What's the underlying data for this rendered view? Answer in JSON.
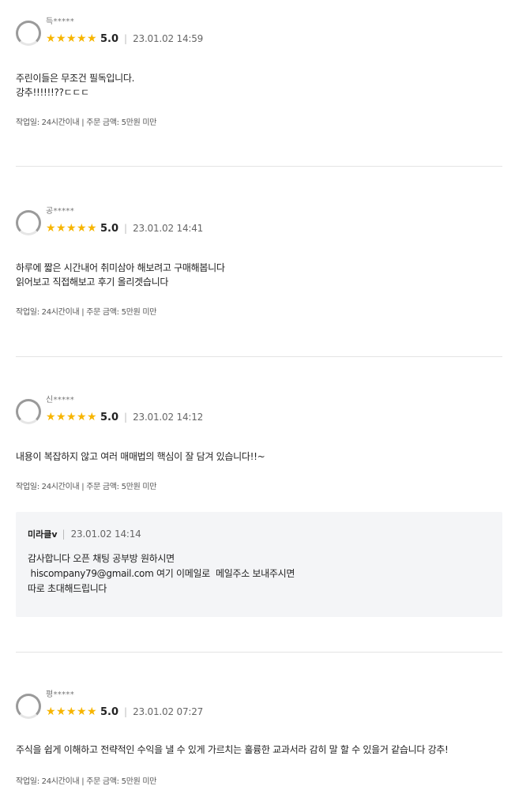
{
  "reviews": [
    {
      "user": "득*****",
      "rating": 5,
      "score": "5.0",
      "date": "23.01.02 14:59",
      "lines": [
        "주린이들은 무조건 필독입니다.",
        "강추!!!!!!??ㄷㄷㄷ"
      ],
      "info": "작업일: 24시간이내 | 주문 금액: 5만원 미만"
    },
    {
      "user": "공*****",
      "rating": 5,
      "score": "5.0",
      "date": "23.01.02 14:41",
      "lines": [
        "하루에 짧은 시간내어 취미삼아 해보려고 구매해봅니다",
        "읽어보고 직접해보고 후기 올리겟습니다"
      ],
      "info": "작업일: 24시간이내 | 주문 금액: 5만원 미만"
    },
    {
      "user": "신*****",
      "rating": 5,
      "score": "5.0",
      "date": "23.01.02 14:12",
      "lines": [
        "내용이 복잡하지 않고 여러 매매법의 핵심이 잘 담겨 있습니다!!~"
      ],
      "info": "작업일: 24시간이내 | 주문 금액: 5만원 미만",
      "reply": {
        "seller": "미라클v",
        "date": "23.01.02 14:14",
        "lines": [
          "감사합니다 오픈 채팅 공부방 원하시면",
          " hiscompany79@gmail.com 여기 이메일로  메일주소 보내주시면",
          "따로 초대해드립니다"
        ]
      }
    },
    {
      "user": "평*****",
      "rating": 5,
      "score": "5.0",
      "date": "23.01.02 07:27",
      "lines": [
        "주식을 쉽게 이해하고 전략적인 수익을 낼 수 있게 가르치는 훌륭한 교과서라 감히 말 할 수 있을거 같습니다 강추!"
      ],
      "info": "작업일: 24시간이내 | 주문 금액: 5만원 미만"
    }
  ],
  "separator": "|",
  "star_glyph": "★",
  "star_color": "#f7b500",
  "reply_bg_color": "#f4f5f7"
}
